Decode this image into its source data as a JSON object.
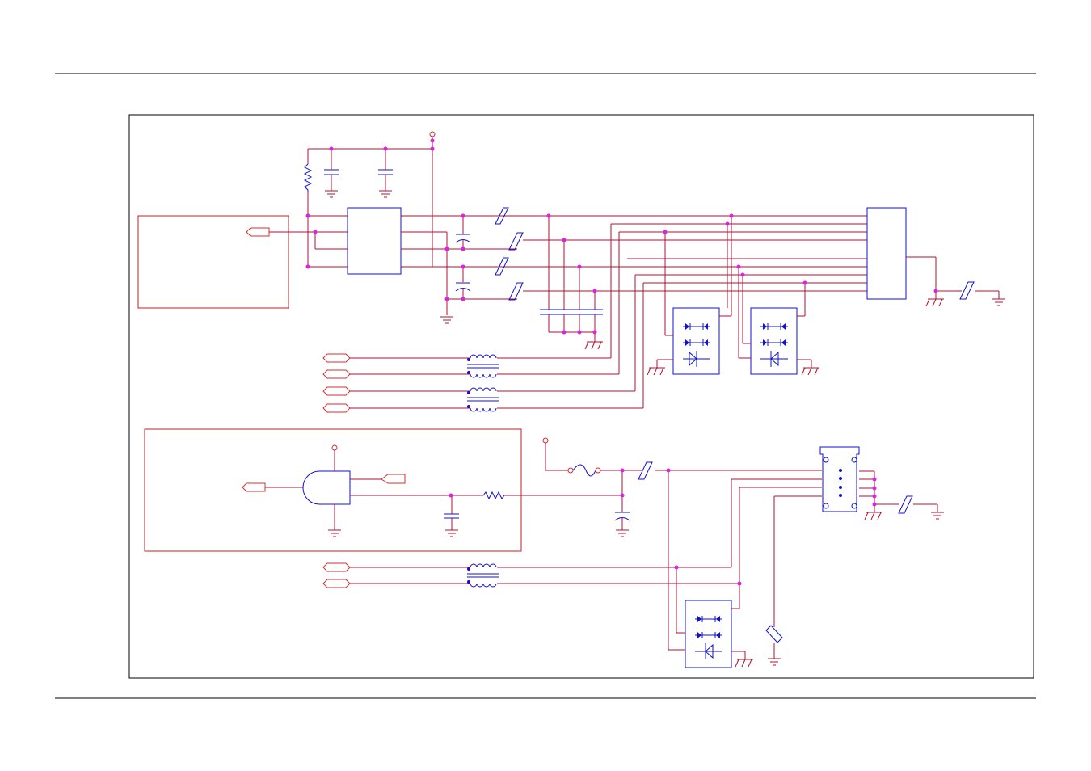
{
  "page": {
    "title": "",
    "text_labels": []
  },
  "colors": {
    "wire": "#b01030",
    "component": "#1010d0",
    "junction": "#e020e0",
    "frame": "#000000",
    "port": "#d03030"
  },
  "components": {
    "ics": [
      "ic-u1",
      "connector-block",
      "and-gate",
      "rj-jack"
    ],
    "capacitors": 8,
    "resistors": 2,
    "common_mode_chokes": 3,
    "diode_bridges": 3,
    "ferrite_beads": 7,
    "fuse": 1,
    "off_page_ports": 9
  }
}
